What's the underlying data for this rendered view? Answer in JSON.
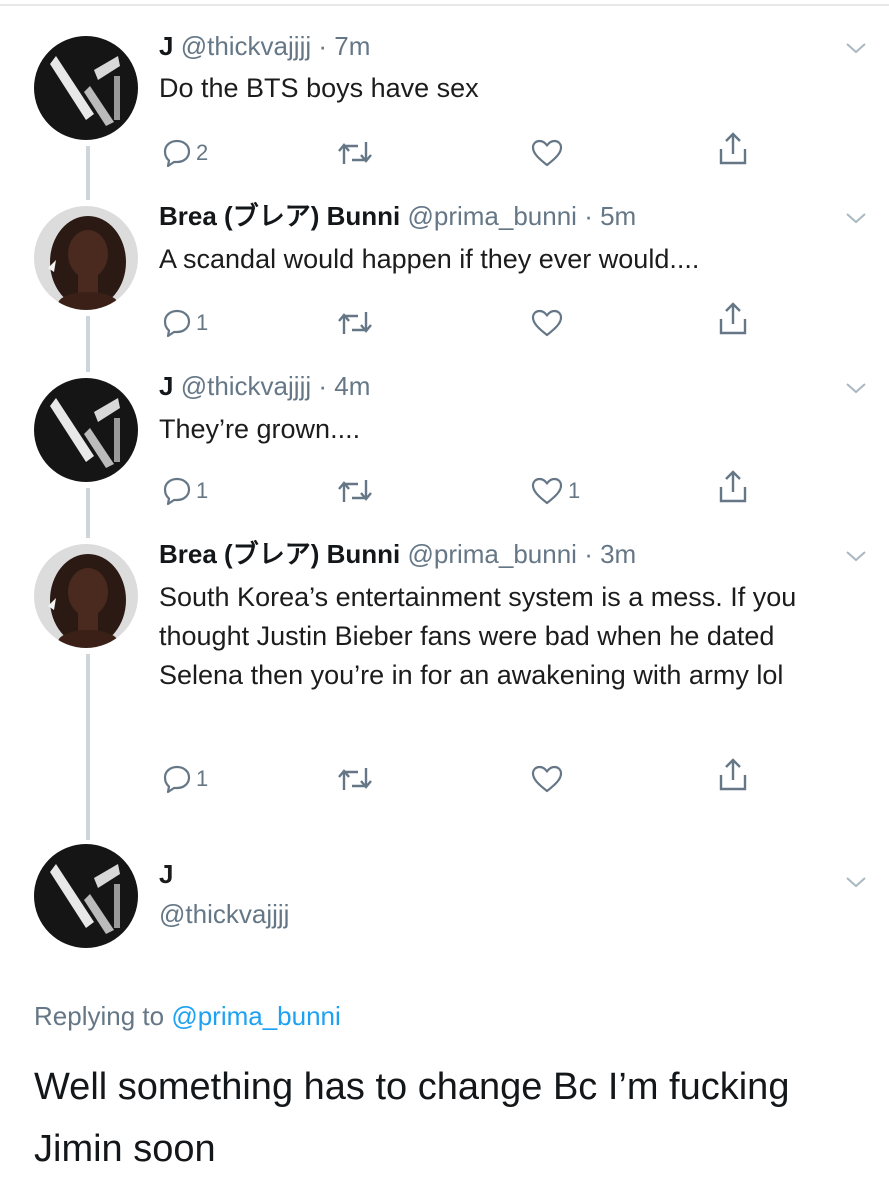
{
  "thread": [
    {
      "name": "J",
      "handle": "@thickvajjjj",
      "sep": "·",
      "time": "7m",
      "text": "Do the BTS boys have sex",
      "reply_count": "2",
      "retweet_count": "",
      "like_count": ""
    },
    {
      "name": "Brea (ブレア) Bunni",
      "handle": "@prima_bunni",
      "sep": "·",
      "time": "5m",
      "text": "A scandal would happen if they ever would....",
      "reply_count": "1",
      "retweet_count": "",
      "like_count": ""
    },
    {
      "name": "J",
      "handle": "@thickvajjjj",
      "sep": "·",
      "time": "4m",
      "text": "They’re grown....",
      "reply_count": "1",
      "retweet_count": "",
      "like_count": "1"
    },
    {
      "name": "Brea (ブレア) Bunni",
      "handle": "@prima_bunni",
      "sep": "·",
      "time": "3m",
      "text": "South Korea’s entertainment system is a mess. If you thought Justin Bieber fans were bad when he dated Selena then you’re in for an awakening with army lol",
      "reply_count": "1",
      "retweet_count": "",
      "like_count": ""
    }
  ],
  "main_tweet": {
    "name": "J",
    "handle": "@thickvajjjj",
    "replying_prefix": "Replying to",
    "replying_to": "@prima_bunni",
    "text": "Well something has to change Bc I’m fucking Jimin soon"
  },
  "icons": {
    "reply": "reply-icon",
    "retweet": "retweet-icon",
    "like": "heart-icon",
    "share": "share-icon",
    "chevron": "chevron-down-icon",
    "avatar_j": "avatar-j",
    "avatar_brea": "avatar-brea"
  },
  "colors": {
    "text": "#14171a",
    "secondary": "#657786",
    "link": "#1da1f2",
    "thread_line": "#cfd6db"
  }
}
